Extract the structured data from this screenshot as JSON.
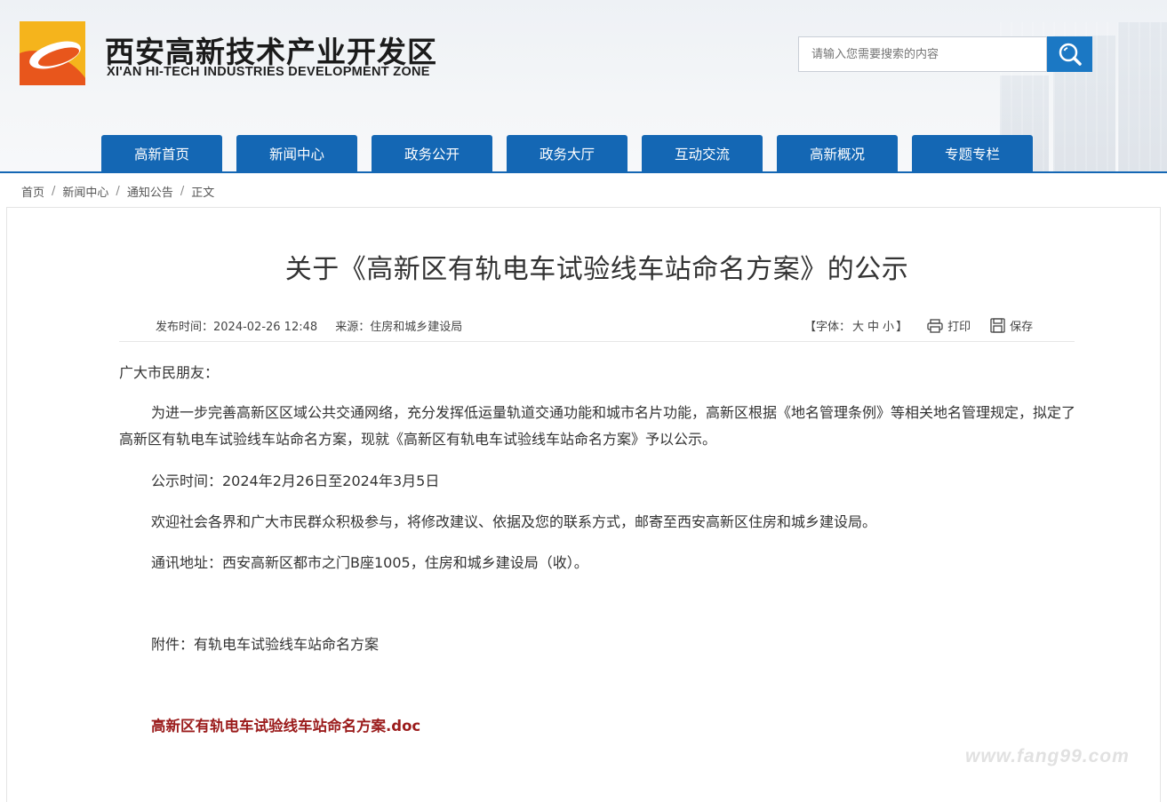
{
  "header": {
    "site_name_cn": "西安高新技术产业开发区",
    "site_name_en": "XI'AN HI-TECH INDUSTRIES DEVELOPMENT ZONE",
    "search_placeholder": "请输入您需要搜索的内容",
    "search_icon": "search-icon"
  },
  "nav": {
    "items": [
      {
        "label": "高新首页"
      },
      {
        "label": "新闻中心"
      },
      {
        "label": "政务公开"
      },
      {
        "label": "政务大厅"
      },
      {
        "label": "互动交流"
      },
      {
        "label": "高新概况"
      },
      {
        "label": "专题专栏"
      }
    ]
  },
  "breadcrumb": {
    "items": [
      "首页",
      "新闻中心",
      "通知公告",
      "正文"
    ],
    "separator": "/"
  },
  "article": {
    "title": "关于《高新区有轨电车试验线车站命名方案》的公示",
    "publish_time": "发布时间：2024-02-26 12:48",
    "source": "来源：住房和城乡建设局",
    "font_label": "【字体：",
    "font_large": "大",
    "font_medium": "中",
    "font_small": "小",
    "font_close": "】",
    "print_label": "打印",
    "save_label": "保存",
    "greeting": "广大市民朋友：",
    "paragraph_1": "为进一步完善高新区区域公共交通网络，充分发挥低运量轨道交通功能和城市名片功能，高新区根据《地名管理条例》等相关地名管理规定，拟定了高新区有轨电车试验线车站命名方案，现就《高新区有轨电车试验线车站命名方案》予以公示。",
    "notice_period": "公示时间：2024年2月26日至2024年3月5日",
    "invitation": "欢迎社会各界和广大市民群众积极参与，将修改建议、依据及您的联系方式，邮寄至西安高新区住房和城乡建设局。",
    "address": "通讯地址：西安高新区都市之门B座1005，住房和城乡建设局（收）。",
    "attachment_label": "附件：有轨电车试验线车站命名方案",
    "attachment_file": "高新区有轨电车试验线车站命名方案.doc"
  },
  "watermark": "www.fang99.com",
  "colors": {
    "nav_blue": "#1467b4",
    "search_blue": "#1b78c4",
    "link_red": "#9b1c1c",
    "logo_orange": "#e8561c",
    "logo_yellow": "#f5b41c"
  }
}
